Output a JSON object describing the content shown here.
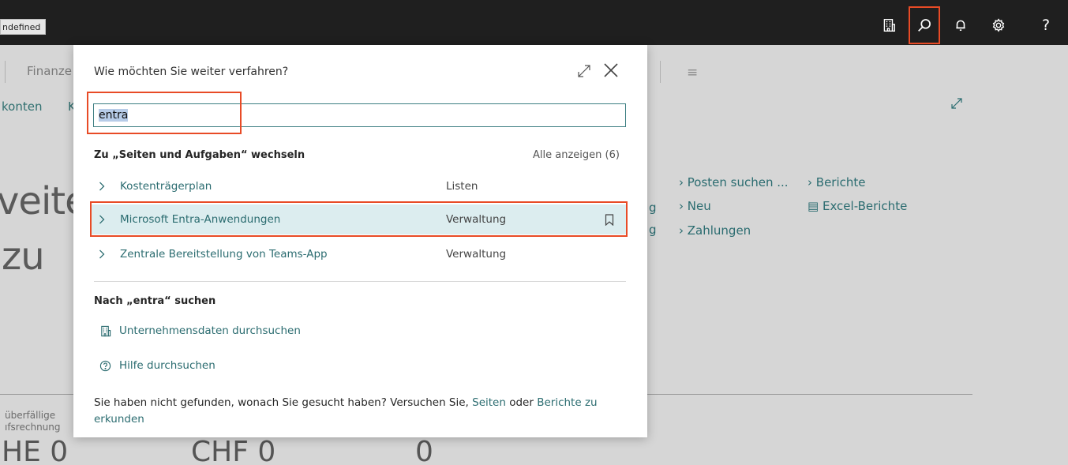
{
  "topbar": {
    "env_badge": "ndefined",
    "help_glyph": "?",
    "icons": [
      "company-icon",
      "search-icon",
      "bell-icon",
      "gear-icon",
      "help-icon"
    ],
    "active_color": "#e84b26"
  },
  "background": {
    "nav_label": "Finanze",
    "sub_nav": [
      "konten",
      "K"
    ],
    "headline": [
      "veite",
      "zu"
    ],
    "truncated_g": [
      "g",
      "g"
    ],
    "links": [
      "Posten suchen ...",
      "Neu",
      "Zahlungen",
      "Berichte",
      "Excel-Berichte"
    ],
    "tile_label_lines": [
      "überfällige",
      "ıfsrechnung"
    ],
    "tile_values": [
      "HE 0",
      "CHF 0",
      "0"
    ]
  },
  "dialog": {
    "title": "Wie möchten Sie weiter verfahren?",
    "search_value": "entra",
    "section_pages": "Zu „Seiten und Aufgaben“ wechseln",
    "show_all": "Alle anzeigen (6)",
    "results": [
      {
        "name": "Kostenträgerplan",
        "category": "Listen"
      },
      {
        "name": "Microsoft Entra-Anwendungen",
        "category": "Verwaltung"
      },
      {
        "name": "Zentrale Bereitstellung von Teams-App",
        "category": "Verwaltung"
      }
    ],
    "section_search": "Nach „entra“ suchen",
    "actions": [
      "Unternehmensdaten durchsuchen",
      "Hilfe durchsuchen"
    ],
    "footer": {
      "prefix": "Sie haben nicht gefunden, wonach Sie gesucht haben? Versuchen Sie,",
      "link_pages": "Seiten",
      "middle": "oder",
      "link_reports": "Berichte zu erkunden"
    },
    "accent_color": "#2b6c70",
    "selected_row_bg": "#dcedef"
  }
}
